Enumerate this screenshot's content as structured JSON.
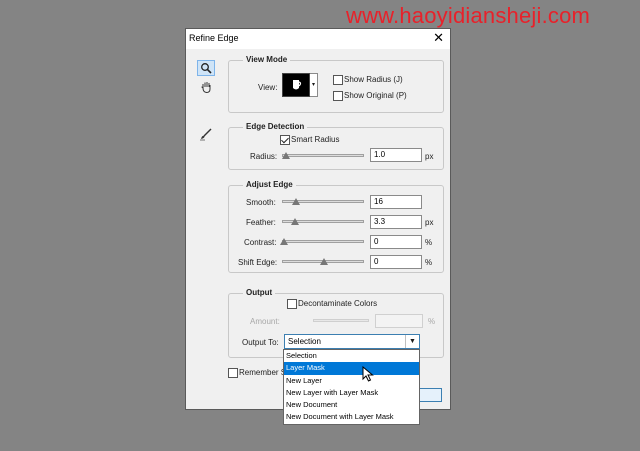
{
  "watermark": "www.haoyidiansheji.com",
  "dialog": {
    "title": "Refine Edge",
    "close_glyph": "✕"
  },
  "tools": {
    "zoom": "zoom-icon",
    "hand": "hand-icon",
    "refine_brush": "refine-radius-brush-icon"
  },
  "view_mode": {
    "title": "View Mode",
    "view_label": "View:",
    "show_radius": {
      "label": "Show Radius (J)",
      "checked": false
    },
    "show_original": {
      "label": "Show Original (P)",
      "checked": false
    }
  },
  "edge_detection": {
    "title": "Edge Detection",
    "smart_radius": {
      "label": "Smart Radius",
      "checked": true
    },
    "radius": {
      "label": "Radius:",
      "value": "1.0",
      "unit": "px",
      "level": 0.03
    }
  },
  "adjust_edge": {
    "title": "Adjust Edge",
    "smooth": {
      "label": "Smooth:",
      "value": "16",
      "unit": "",
      "level": 0.16
    },
    "feather": {
      "label": "Feather:",
      "value": "3.3",
      "unit": "px",
      "level": 0.14
    },
    "contrast": {
      "label": "Contrast:",
      "value": "0",
      "unit": "%",
      "level": 0.0
    },
    "shift_edge": {
      "label": "Shift Edge:",
      "value": "0",
      "unit": "%",
      "level": 0.5
    }
  },
  "output": {
    "title": "Output",
    "decontaminate": {
      "label": "Decontaminate Colors",
      "checked": false
    },
    "amount": {
      "label": "Amount:",
      "value": "",
      "unit": "%"
    },
    "output_to_label": "Output To:",
    "output_to_value": "Selection",
    "options": [
      "Selection",
      "Layer Mask",
      "New Layer",
      "New Layer with Layer Mask",
      "New Document",
      "New Document with Layer Mask"
    ],
    "highlighted_option": "Layer Mask"
  },
  "remember": {
    "label": "Remember Se",
    "checked": false
  },
  "colors": {
    "highlight": "#0078d7",
    "watermark": "#e8212a",
    "accent_border": "#3c7fb1"
  }
}
